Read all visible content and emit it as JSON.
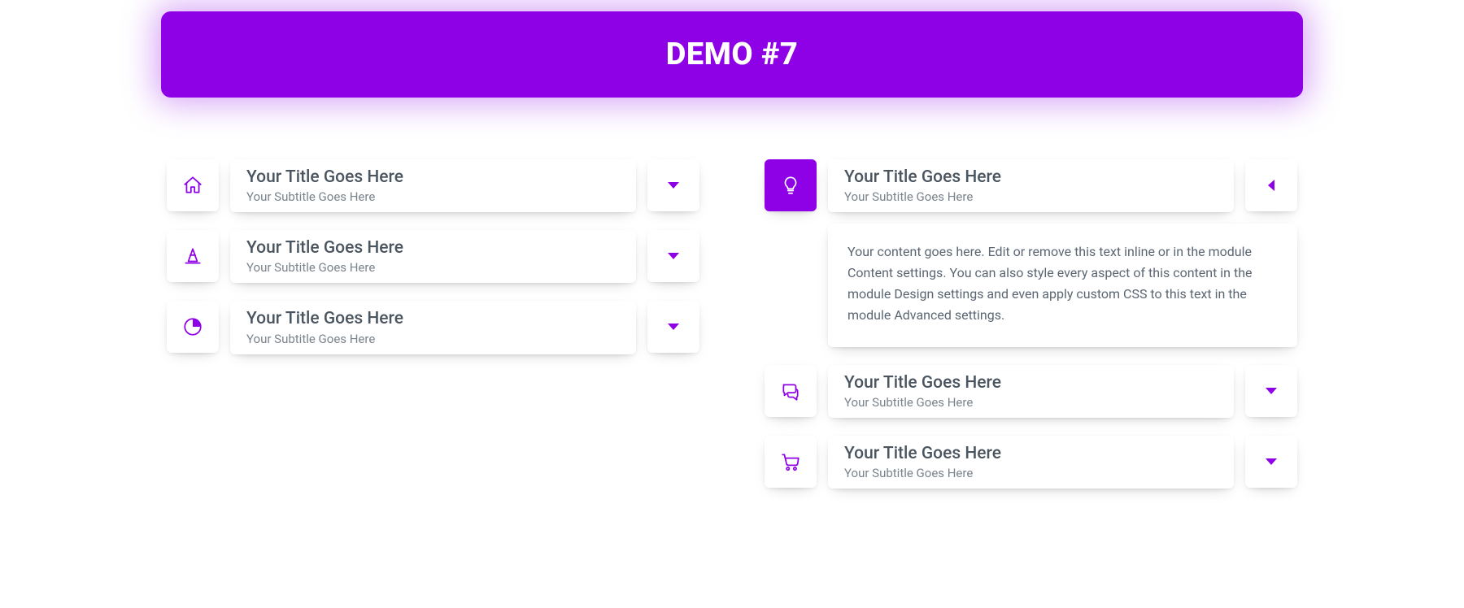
{
  "banner": {
    "title": "DEMO #7"
  },
  "colors": {
    "accent": "#8E00E6"
  },
  "left_column": {
    "items": [
      {
        "icon": "home-icon",
        "title": "Your Title Goes Here",
        "subtitle": "Your Subtitle Goes Here",
        "expanded": false
      },
      {
        "icon": "cone-icon",
        "title": "Your Title Goes Here",
        "subtitle": "Your Subtitle Goes Here",
        "expanded": false
      },
      {
        "icon": "pie-chart-icon",
        "title": "Your Title Goes Here",
        "subtitle": "Your Subtitle Goes Here",
        "expanded": false
      }
    ]
  },
  "right_column": {
    "items": [
      {
        "icon": "lightbulb-icon",
        "title": "Your Title Goes Here",
        "subtitle": "Your Subtitle Goes Here",
        "expanded": true,
        "content": "Your content goes here. Edit or remove this text inline or in the module Content settings. You can also style every aspect of this content in the module Design settings and even apply custom CSS to this text in the module Advanced settings."
      },
      {
        "icon": "comments-icon",
        "title": "Your Title Goes Here",
        "subtitle": "Your Subtitle Goes Here",
        "expanded": false
      },
      {
        "icon": "cart-icon",
        "title": "Your Title Goes Here",
        "subtitle": "Your Subtitle Goes Here",
        "expanded": false
      }
    ]
  }
}
